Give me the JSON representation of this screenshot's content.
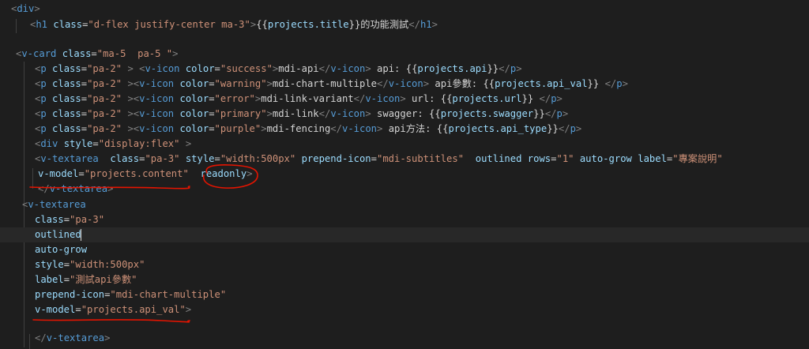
{
  "colors": {
    "background": "#1e1e1e",
    "tag": "#569cd6",
    "attribute": "#9cdcfe",
    "string": "#ce9178",
    "punctuation": "#808080",
    "text": "#d4d4d4",
    "annotation": "#e51400"
  },
  "lines": [
    [
      {
        "c": "tg",
        "t": "<"
      },
      {
        "c": "tn",
        "t": "div"
      },
      {
        "c": "tg",
        "t": ">"
      }
    ],
    [
      {
        "c": "tg",
        "t": "<"
      },
      {
        "c": "tn",
        "t": "h1"
      },
      {
        "c": "tx",
        "t": " "
      },
      {
        "c": "an",
        "t": "class"
      },
      {
        "c": "tx",
        "t": "="
      },
      {
        "c": "av",
        "t": "\"d-flex justify-center ma-3\""
      },
      {
        "c": "tg",
        "t": ">"
      },
      {
        "c": "tx",
        "t": "{{"
      },
      {
        "c": "ex",
        "t": "projects.title"
      },
      {
        "c": "tx",
        "t": "}}的功能測試"
      },
      {
        "c": "tg",
        "t": "</"
      },
      {
        "c": "tn",
        "t": "h1"
      },
      {
        "c": "tg",
        "t": ">"
      }
    ],
    [],
    [
      {
        "c": "tg",
        "t": "<"
      },
      {
        "c": "tn",
        "t": "v-card"
      },
      {
        "c": "tx",
        "t": " "
      },
      {
        "c": "an",
        "t": "class"
      },
      {
        "c": "tx",
        "t": "="
      },
      {
        "c": "av",
        "t": "\"ma-5  pa-5 \""
      },
      {
        "c": "tg",
        "t": ">"
      }
    ],
    [
      {
        "c": "tg",
        "t": "<"
      },
      {
        "c": "tn",
        "t": "p"
      },
      {
        "c": "tx",
        "t": " "
      },
      {
        "c": "an",
        "t": "class"
      },
      {
        "c": "tx",
        "t": "="
      },
      {
        "c": "av",
        "t": "\"pa-2\""
      },
      {
        "c": "tx",
        "t": " "
      },
      {
        "c": "tg",
        "t": ">"
      },
      {
        "c": "tx",
        "t": " "
      },
      {
        "c": "tg",
        "t": "<"
      },
      {
        "c": "tn",
        "t": "v-icon"
      },
      {
        "c": "tx",
        "t": " "
      },
      {
        "c": "an",
        "t": "color"
      },
      {
        "c": "tx",
        "t": "="
      },
      {
        "c": "av",
        "t": "\"success\""
      },
      {
        "c": "tg",
        "t": ">"
      },
      {
        "c": "tx",
        "t": "mdi-api"
      },
      {
        "c": "tg",
        "t": "</"
      },
      {
        "c": "tn",
        "t": "v-icon"
      },
      {
        "c": "tg",
        "t": ">"
      },
      {
        "c": "tx",
        "t": " api: {{"
      },
      {
        "c": "ex",
        "t": "projects.api"
      },
      {
        "c": "tx",
        "t": "}}"
      },
      {
        "c": "tg",
        "t": "</"
      },
      {
        "c": "tn",
        "t": "p"
      },
      {
        "c": "tg",
        "t": ">"
      }
    ],
    [
      {
        "c": "tg",
        "t": "<"
      },
      {
        "c": "tn",
        "t": "p"
      },
      {
        "c": "tx",
        "t": " "
      },
      {
        "c": "an",
        "t": "class"
      },
      {
        "c": "tx",
        "t": "="
      },
      {
        "c": "av",
        "t": "\"pa-2\""
      },
      {
        "c": "tx",
        "t": " "
      },
      {
        "c": "tg",
        "t": ">"
      },
      {
        "c": "tg",
        "t": "<"
      },
      {
        "c": "tn",
        "t": "v-icon"
      },
      {
        "c": "tx",
        "t": " "
      },
      {
        "c": "an",
        "t": "color"
      },
      {
        "c": "tx",
        "t": "="
      },
      {
        "c": "av",
        "t": "\"warning\""
      },
      {
        "c": "tg",
        "t": ">"
      },
      {
        "c": "tx",
        "t": "mdi-chart-multiple"
      },
      {
        "c": "tg",
        "t": "</"
      },
      {
        "c": "tn",
        "t": "v-icon"
      },
      {
        "c": "tg",
        "t": ">"
      },
      {
        "c": "tx",
        "t": " api參數: {{"
      },
      {
        "c": "ex",
        "t": "projects.api_val"
      },
      {
        "c": "tx",
        "t": "}} "
      },
      {
        "c": "tg",
        "t": "</"
      },
      {
        "c": "tn",
        "t": "p"
      },
      {
        "c": "tg",
        "t": ">"
      }
    ],
    [
      {
        "c": "tg",
        "t": "<"
      },
      {
        "c": "tn",
        "t": "p"
      },
      {
        "c": "tx",
        "t": " "
      },
      {
        "c": "an",
        "t": "class"
      },
      {
        "c": "tx",
        "t": "="
      },
      {
        "c": "av",
        "t": "\"pa-2\""
      },
      {
        "c": "tx",
        "t": " "
      },
      {
        "c": "tg",
        "t": ">"
      },
      {
        "c": "tg",
        "t": "<"
      },
      {
        "c": "tn",
        "t": "v-icon"
      },
      {
        "c": "tx",
        "t": " "
      },
      {
        "c": "an",
        "t": "color"
      },
      {
        "c": "tx",
        "t": "="
      },
      {
        "c": "av",
        "t": "\"error\""
      },
      {
        "c": "tg",
        "t": ">"
      },
      {
        "c": "tx",
        "t": "mdi-link-variant"
      },
      {
        "c": "tg",
        "t": "</"
      },
      {
        "c": "tn",
        "t": "v-icon"
      },
      {
        "c": "tg",
        "t": ">"
      },
      {
        "c": "tx",
        "t": " url: {{"
      },
      {
        "c": "ex",
        "t": "projects.url"
      },
      {
        "c": "tx",
        "t": "}} "
      },
      {
        "c": "tg",
        "t": "</"
      },
      {
        "c": "tn",
        "t": "p"
      },
      {
        "c": "tg",
        "t": ">"
      }
    ],
    [
      {
        "c": "tg",
        "t": "<"
      },
      {
        "c": "tn",
        "t": "p"
      },
      {
        "c": "tx",
        "t": " "
      },
      {
        "c": "an",
        "t": "class"
      },
      {
        "c": "tx",
        "t": "="
      },
      {
        "c": "av",
        "t": "\"pa-2\""
      },
      {
        "c": "tx",
        "t": " "
      },
      {
        "c": "tg",
        "t": ">"
      },
      {
        "c": "tg",
        "t": "<"
      },
      {
        "c": "tn",
        "t": "v-icon"
      },
      {
        "c": "tx",
        "t": " "
      },
      {
        "c": "an",
        "t": "color"
      },
      {
        "c": "tx",
        "t": "="
      },
      {
        "c": "av",
        "t": "\"primary\""
      },
      {
        "c": "tg",
        "t": ">"
      },
      {
        "c": "tx",
        "t": "mdi-link"
      },
      {
        "c": "tg",
        "t": "</"
      },
      {
        "c": "tn",
        "t": "v-icon"
      },
      {
        "c": "tg",
        "t": ">"
      },
      {
        "c": "tx",
        "t": " swagger: {{"
      },
      {
        "c": "ex",
        "t": "projects.swagger"
      },
      {
        "c": "tx",
        "t": "}}"
      },
      {
        "c": "tg",
        "t": "</"
      },
      {
        "c": "tn",
        "t": "p"
      },
      {
        "c": "tg",
        "t": ">"
      }
    ],
    [
      {
        "c": "tg",
        "t": "<"
      },
      {
        "c": "tn",
        "t": "p"
      },
      {
        "c": "tx",
        "t": " "
      },
      {
        "c": "an",
        "t": "class"
      },
      {
        "c": "tx",
        "t": "="
      },
      {
        "c": "av",
        "t": "\"pa-2\""
      },
      {
        "c": "tx",
        "t": " "
      },
      {
        "c": "tg",
        "t": ">"
      },
      {
        "c": "tg",
        "t": "<"
      },
      {
        "c": "tn",
        "t": "v-icon"
      },
      {
        "c": "tx",
        "t": " "
      },
      {
        "c": "an",
        "t": "color"
      },
      {
        "c": "tx",
        "t": "="
      },
      {
        "c": "av",
        "t": "\"purple\""
      },
      {
        "c": "tg",
        "t": ">"
      },
      {
        "c": "tx",
        "t": "mdi-fencing"
      },
      {
        "c": "tg",
        "t": "</"
      },
      {
        "c": "tn",
        "t": "v-icon"
      },
      {
        "c": "tg",
        "t": ">"
      },
      {
        "c": "tx",
        "t": " api方法: {{"
      },
      {
        "c": "ex",
        "t": "projects.api_type"
      },
      {
        "c": "tx",
        "t": "}}"
      },
      {
        "c": "tg",
        "t": "</"
      },
      {
        "c": "tn",
        "t": "p"
      },
      {
        "c": "tg",
        "t": ">"
      }
    ],
    [
      {
        "c": "tg",
        "t": "<"
      },
      {
        "c": "tn",
        "t": "div"
      },
      {
        "c": "tx",
        "t": " "
      },
      {
        "c": "an",
        "t": "style"
      },
      {
        "c": "tx",
        "t": "="
      },
      {
        "c": "av",
        "t": "\"display:flex\""
      },
      {
        "c": "tx",
        "t": " "
      },
      {
        "c": "tg",
        "t": ">"
      }
    ],
    [
      {
        "c": "tg",
        "t": "<"
      },
      {
        "c": "tn",
        "t": "v-textarea"
      },
      {
        "c": "tx",
        "t": "  "
      },
      {
        "c": "an",
        "t": "class"
      },
      {
        "c": "tx",
        "t": "="
      },
      {
        "c": "av",
        "t": "\"pa-3\""
      },
      {
        "c": "tx",
        "t": " "
      },
      {
        "c": "an",
        "t": "style"
      },
      {
        "c": "tx",
        "t": "="
      },
      {
        "c": "av",
        "t": "\"width:500px\""
      },
      {
        "c": "tx",
        "t": " "
      },
      {
        "c": "an",
        "t": "prepend-icon"
      },
      {
        "c": "tx",
        "t": "="
      },
      {
        "c": "av",
        "t": "\"mdi-subtitles\""
      },
      {
        "c": "tx",
        "t": "  "
      },
      {
        "c": "an",
        "t": "outlined"
      },
      {
        "c": "tx",
        "t": " "
      },
      {
        "c": "an",
        "t": "rows"
      },
      {
        "c": "tx",
        "t": "="
      },
      {
        "c": "av",
        "t": "\"1\""
      },
      {
        "c": "tx",
        "t": " "
      },
      {
        "c": "an",
        "t": "auto-grow"
      },
      {
        "c": "tx",
        "t": " "
      },
      {
        "c": "an",
        "t": "label"
      },
      {
        "c": "tx",
        "t": "="
      },
      {
        "c": "av",
        "t": "\"專案說明\""
      }
    ],
    [
      {
        "c": "an",
        "t": "v-model"
      },
      {
        "c": "tx",
        "t": "="
      },
      {
        "c": "av",
        "t": "\"projects.content\""
      },
      {
        "c": "tx",
        "t": "  "
      },
      {
        "c": "an",
        "t": "readonly"
      },
      {
        "c": "tg",
        "t": ">"
      }
    ],
    [
      {
        "c": "tg",
        "t": "</"
      },
      {
        "c": "tn",
        "t": "v-textarea"
      },
      {
        "c": "tg",
        "t": ">"
      }
    ],
    [
      {
        "c": "tg",
        "t": "<"
      },
      {
        "c": "tn",
        "t": "v-textarea"
      }
    ],
    [
      {
        "c": "an",
        "t": "class"
      },
      {
        "c": "tx",
        "t": "="
      },
      {
        "c": "av",
        "t": "\"pa-3\""
      }
    ],
    [
      {
        "c": "an",
        "t": "outlined"
      }
    ],
    [
      {
        "c": "an",
        "t": "auto-grow"
      }
    ],
    [
      {
        "c": "an",
        "t": "style"
      },
      {
        "c": "tx",
        "t": "="
      },
      {
        "c": "av",
        "t": "\"width:500px\""
      }
    ],
    [
      {
        "c": "an",
        "t": "label"
      },
      {
        "c": "tx",
        "t": "="
      },
      {
        "c": "av",
        "t": "\"測試api參數\""
      }
    ],
    [
      {
        "c": "an",
        "t": "prepend-icon"
      },
      {
        "c": "tx",
        "t": "="
      },
      {
        "c": "av",
        "t": "\"mdi-chart-multiple\""
      }
    ],
    [
      {
        "c": "an",
        "t": "v-model"
      },
      {
        "c": "tx",
        "t": "="
      },
      {
        "c": "av",
        "t": "\"projects.api_val\""
      },
      {
        "c": "tg",
        "t": ">"
      }
    ],
    [],
    [
      {
        "c": "tg",
        "t": "</"
      },
      {
        "c": "tn",
        "t": "v-textarea"
      },
      {
        "c": "tg",
        "t": ">"
      }
    ]
  ]
}
